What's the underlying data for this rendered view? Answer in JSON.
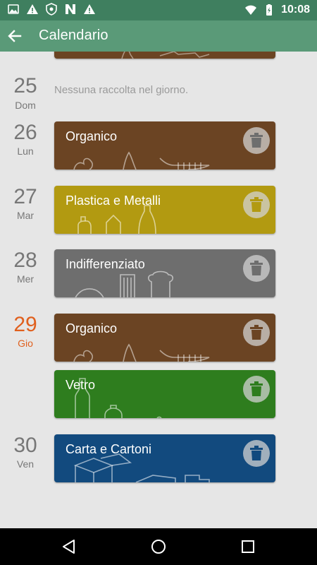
{
  "status_bar": {
    "time": "10:08",
    "left_icons": [
      "gallery-icon",
      "alert-icon",
      "shield-icon",
      "n-logo-icon",
      "alert-icon"
    ],
    "right_icons": [
      "wifi-icon",
      "battery-charging-icon"
    ]
  },
  "app_bar": {
    "title": "Calendario"
  },
  "colors": {
    "organico": "#6b4423",
    "plastica": "#b29a11",
    "indifferenziato": "#6e6e6e",
    "vetro": "#2e7d1e",
    "carta": "#124a7e",
    "today": "#e0601e"
  },
  "days": [
    {
      "number": "25",
      "name": "Dom",
      "empty_text": "Nessuna raccolta nel giorno."
    },
    {
      "number": "26",
      "name": "Lun",
      "cards": [
        {
          "title": "Organico"
        }
      ]
    },
    {
      "number": "27",
      "name": "Mar",
      "cards": [
        {
          "title": "Plastica e Metalli"
        }
      ]
    },
    {
      "number": "28",
      "name": "Mer",
      "cards": [
        {
          "title": "Indifferenziato"
        }
      ]
    },
    {
      "number": "29",
      "name": "Gio",
      "today": true,
      "cards": [
        {
          "title": "Organico"
        },
        {
          "title": "Vetro"
        }
      ]
    },
    {
      "number": "30",
      "name": "Ven",
      "cards": [
        {
          "title": "Carta e Cartoni"
        }
      ]
    }
  ],
  "nav_bar": [
    "back-nav-icon",
    "home-nav-icon",
    "recents-nav-icon"
  ]
}
